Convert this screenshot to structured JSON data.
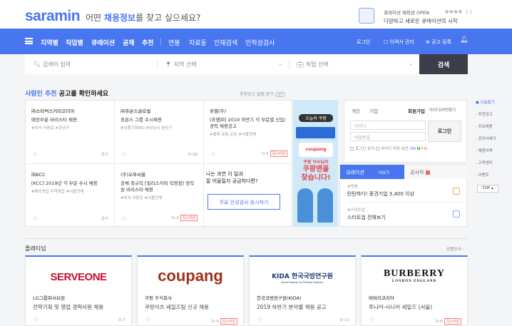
{
  "header": {
    "logo": "saramin",
    "slogan_pre": "어떤 ",
    "slogan_em": "채용정보",
    "slogan_post": "를 찾고 싶으세요?",
    "promo_title": "큐레이션 채용관 OPEN",
    "promo_desc": "다양하고 새로운 큐레이션의 시작"
  },
  "nav": {
    "items": [
      "지역별",
      "직업별",
      "큐레이션",
      "공채",
      "추천",
      "연봉",
      "자료동",
      "인재검색",
      "인적성검사"
    ],
    "right": [
      "로그인",
      "이력서 관리",
      "공고 등록"
    ]
  },
  "search": {
    "keyword_placeholder": "검색어 입력",
    "region_placeholder": "지역 선택",
    "job_placeholder": "직업 선택",
    "button": "검색"
  },
  "recommend": {
    "title_em": "사람인 추천",
    "title_rest": " 공고를 확인하세요",
    "toggle_label": "추천공고 알림 받기",
    "toggle_state": "OFF"
  },
  "jobs": [
    {
      "company": "㈜스타벅스커피코리아",
      "title": "매장부분 바리스타 채용",
      "tags": "#외식·식음료 #관남구",
      "dday": "상시",
      "badge": ""
    },
    {
      "company": "㈜휴온스글로벌",
      "title": "휴온스 그룹 수시채용",
      "tags": "#상품기획MD #성남시 분당구",
      "dday": "D-26",
      "badge": ""
    },
    {
      "company": "휴엠(주)",
      "title": "[휴엠㈜] 2019 하반기 각 부문별 신입/경력 채용공고",
      "tags": "#물류·유통·운송 #서울전체",
      "dday": "D-5",
      "badge": "즉시지원"
    },
    {
      "company": "㈜KCC",
      "title": "[KCC] 2019년 각 부문 수시 채용",
      "tags": "#해외영업·무역영업 #서울전체",
      "dday": "상시",
      "badge": ""
    },
    {
      "company": "(주)오뚜씨울",
      "title": "공채 정규직 [릴리스커피 직영점] 정직원 바리스타 채용",
      "tags": "#외식·식음료 #서울전체",
      "dday": "D-3",
      "badge": "즉시지원"
    }
  ],
  "ask": {
    "line1": "나는 과연 이 일과",
    "line2": "잘 어울릴지 궁금하다면?",
    "button": "무료 인성검사 응시하기"
  },
  "banner": {
    "tag": "오늘의 쿠팡",
    "brand": "coupang",
    "headline1": "쿠팡 이사님이",
    "headline2": "쿠팡맨을",
    "headline3": "찾습니다!"
  },
  "login": {
    "tab_personal": "개인",
    "tab_company": "기업",
    "signup": "회원가입",
    "find": "아이디/비번찾기",
    "id_placeholder": "아이디",
    "pw_placeholder": "비밀번호",
    "button": "로그인",
    "opt1": "로그인 유지",
    "opt2": "아이디 저장",
    "opt3": "보안",
    "opt3_state": "ON"
  },
  "curation": {
    "tab1": "큐레이션",
    "tab1_more": "더보기",
    "tab2": "공사직",
    "items": [
      {
        "tag": "#연봉",
        "title": "탄탄하다! 중견기업 3,400 이상"
      },
      {
        "tag": "#스타트업",
        "title": "스타트업 전체보기"
      }
    ]
  },
  "sidenav": {
    "items": [
      "오늘할기",
      "추천공고",
      "주요채용",
      "공지사세기",
      "채용이력",
      "고객센터",
      "이벤트"
    ],
    "top": "TOP"
  },
  "platinum": {
    "title": "플래티넘",
    "more": "상품안내",
    "cards": [
      {
        "logo": "SERVEONE",
        "company": "LG그룹㈜서브원",
        "title": "전략기획 및 영업 경력사원 채용",
        "dday": "D-7",
        "badge": ""
      },
      {
        "logo": "coupang",
        "company": "쿠팡 주식회사",
        "title": "쿠팡이츠 세일즈팀 신규 채용",
        "dday": "D-4",
        "badge": "즉시지원"
      },
      {
        "logo": "KIDA 한국국방연구원",
        "logo_sub": "Korea Institute for Defense Analyses",
        "company": "한국국방연구원(KIDA)",
        "title": "2019 하반기 분야별 채용 공고",
        "dday": "D-11",
        "badge": ""
      },
      {
        "logo": "BURBERRY",
        "logo_sub": "LONDON ENGLAND",
        "company": "버버리코리아",
        "title": "주니어-시니어 세일즈 (서울)",
        "dday": "D-6",
        "badge": "즉시지원"
      }
    ]
  },
  "colors": {
    "brand": "#4876ef",
    "dark_button": "#3b3e48",
    "badge": "#e55555"
  }
}
